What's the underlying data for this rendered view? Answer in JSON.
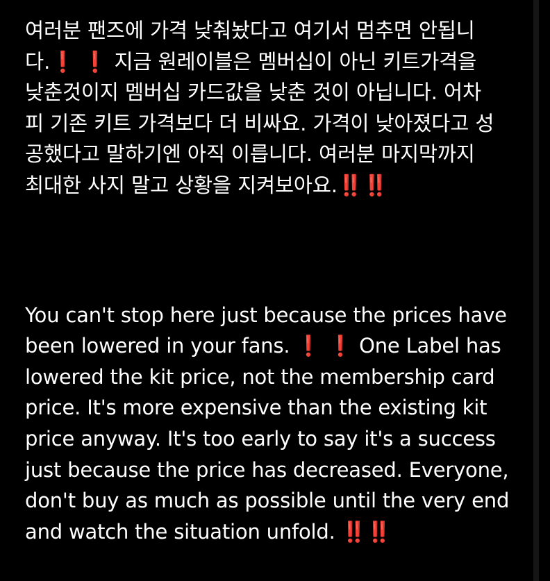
{
  "post": {
    "korean": {
      "part1": "여러분 팬즈에 가격 낮춰놨다고 여기서 멈추면 안됩니\n다.",
      "emoji1": "❗ ❗",
      "part2": " 지금 원레이블은 멤버십이 아닌 키트가격을\n낮춘것이지 멤버십 카드값을 낮춘 것이 아닙니다. 어차\n피 기존 키트 가격보다 더 비싸요. 가격이 낮아졌다고 성\n공했다고 말하기엔 아직 이릅니다. 여러분 마지막까지\n최대한 사지 말고 상황을 지켜보아요.",
      "emoji2": "‼️‼️"
    },
    "english": {
      "part1": "You can't stop here just because the prices have\nbeen lowered in your fans. ",
      "emoji1": "❗ ❗",
      "part2": " One Label has\nlowered the kit price, not the membership card\nprice. It's more expensive than the existing kit\nprice anyway. It's too early to say it's a success\njust because the price has decreased. Everyone,\ndon't buy as much as possible until the very end\nand watch the situation unfold. ",
      "emoji2": "‼️‼️"
    }
  },
  "colors": {
    "background": "#000000",
    "text": "#ffffff",
    "emoji": "#e8273c"
  }
}
